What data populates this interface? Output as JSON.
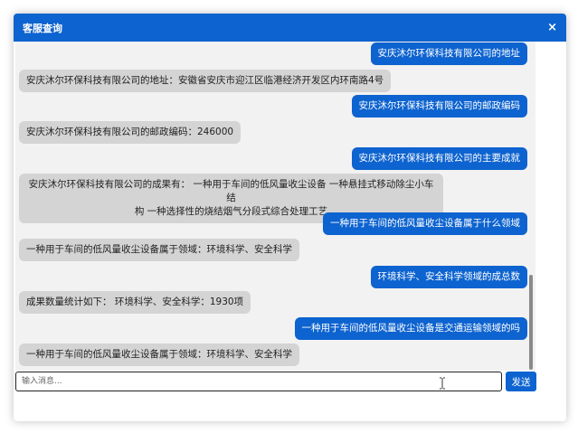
{
  "dialog": {
    "title": "客服查询",
    "close_label": "×"
  },
  "messages": [
    {
      "role": "user",
      "text": "安庆沐尔环保科技有限公司的地址"
    },
    {
      "role": "bot",
      "text": "安庆沐尔环保科技有限公司的地址：安徽省安庆市迎江区临港经济开发区内环南路4号"
    },
    {
      "role": "user",
      "text": "安庆沐尔环保科技有限公司的邮政编码"
    },
    {
      "role": "bot",
      "text": "安庆沐尔环保科技有限公司的邮政编码：246000"
    },
    {
      "role": "user",
      "text": "安庆沐尔环保科技有限公司的主要成就"
    },
    {
      "role": "bot",
      "line1": "安庆沐尔环保科技有限公司的成果有： 一种用于车间的低风量收尘设备 一种悬挂式移动除尘小车结",
      "line2": "构 一种选择性的烧结烟气分段式综合处理工艺"
    },
    {
      "role": "user",
      "text": "一种用于车间的低风量收尘设备属于什么领域"
    },
    {
      "role": "bot",
      "text": "一种用于车间的低风量收尘设备属于领域：环境科学、安全科学"
    },
    {
      "role": "user",
      "text": "环境科学、安全科学领域的成总数"
    },
    {
      "role": "bot",
      "text": "成果数量统计如下： 环境科学、安全科学：1930项"
    },
    {
      "role": "user",
      "text": "一种用于车间的低风量收尘设备是交通运输领域的吗"
    },
    {
      "role": "bot",
      "text": "一种用于车间的低风量收尘设备属于领域：环境科学、安全科学"
    }
  ],
  "input": {
    "placeholder": "输入消息...",
    "value": ""
  },
  "send_label": "发送",
  "colors": {
    "accent": "#0d63cf",
    "bot_bubble": "#d4d4d4",
    "chat_bg": "#f2f2f2"
  }
}
